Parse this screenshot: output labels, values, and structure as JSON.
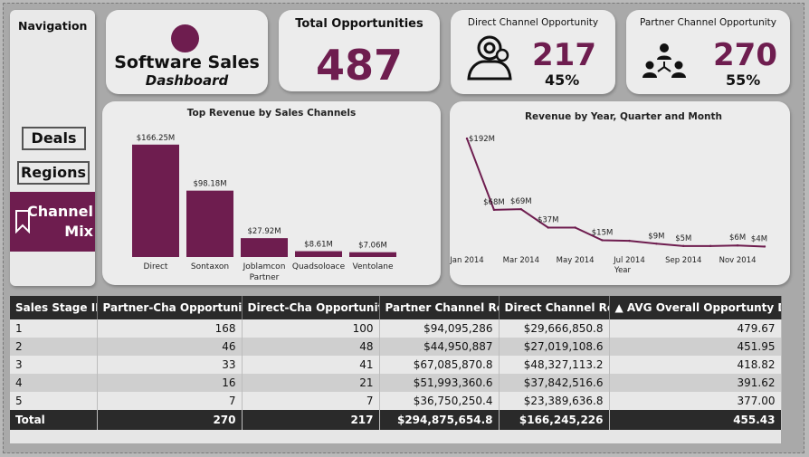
{
  "nav": {
    "title": "Navigation",
    "items": [
      {
        "label": "Deals"
      },
      {
        "label": "Regions"
      },
      {
        "label": "Channel Mix",
        "line1": "Channel",
        "line2": "Mix",
        "active": true,
        "icon": "bookmark-icon"
      }
    ]
  },
  "logo": {
    "title": "Software Sales",
    "subtitle": "Dashboard"
  },
  "kpis": {
    "total": {
      "label": "Total Opportunities",
      "value": "487"
    },
    "direct": {
      "label": "Direct Channel Opportunity",
      "value": "217",
      "pct": "45%",
      "icon": "webcam-user-icon"
    },
    "partner": {
      "label": "Partner Channel Opportunity",
      "value": "270",
      "pct": "55%",
      "icon": "team-network-icon"
    }
  },
  "colors": {
    "accent": "#6e1d4f",
    "dark": "#2a2a2a"
  },
  "chart_data": [
    {
      "type": "bar",
      "title": "Top Revenue by Sales Channels",
      "categories": [
        "Direct",
        "Sontaxon",
        "Joblamcon Partner",
        "Quadsoloace",
        "Ventolane"
      ],
      "category_lines": [
        [
          "Direct"
        ],
        [
          "Sontaxon"
        ],
        [
          "Joblamcon",
          "Partner"
        ],
        [
          "Quadsoloace"
        ],
        [
          "Ventolane"
        ]
      ],
      "values": [
        166.25,
        98.18,
        27.92,
        8.61,
        7.06
      ],
      "data_labels": [
        "$166.25M",
        "$98.18M",
        "$27.92M",
        "$8.61M",
        "$7.06M"
      ],
      "ylim": [
        0,
        170
      ]
    },
    {
      "type": "line",
      "title": "Revenue by Year, Quarter and Month",
      "xlabel": "Year",
      "x": [
        "Jan 2014",
        "Feb 2014",
        "Mar 2014",
        "Apr 2014",
        "May 2014",
        "Jun 2014",
        "Jul 2014",
        "Aug 2014",
        "Sep 2014",
        "Oct 2014",
        "Nov 2014",
        "Dec 2014"
      ],
      "x_tick_labels": [
        "Jan 2014",
        "Mar 2014",
        "May 2014",
        "Jul 2014",
        "Sep 2014",
        "Nov 2014"
      ],
      "values": [
        192,
        68,
        69,
        37,
        37,
        15,
        14,
        9,
        5,
        5,
        6,
        4
      ],
      "data_labels": [
        "$192M",
        "$68M",
        "$69M",
        "$37M",
        "",
        "$15M",
        "",
        "$9M",
        "$5M",
        "",
        "$6M",
        "$4M"
      ],
      "ylim": [
        0,
        200
      ]
    }
  ],
  "table": {
    "columns": [
      "Sales Stage ID",
      "Partner-Cha Opportunity",
      "Direct-Cha Opportunity",
      "Partner Channel Rev",
      "Direct Channel Rev",
      "AVG Overall Opportunty Days"
    ],
    "sort_indicator": "▲",
    "rows": [
      [
        "1",
        "168",
        "100",
        "$94,095,286",
        "$29,666,850.8",
        "479.67"
      ],
      [
        "2",
        "46",
        "48",
        "$44,950,887",
        "$27,019,108.6",
        "451.95"
      ],
      [
        "3",
        "33",
        "41",
        "$67,085,870.8",
        "$48,327,113.2",
        "418.82"
      ],
      [
        "4",
        "16",
        "21",
        "$51,993,360.6",
        "$37,842,516.6",
        "391.62"
      ],
      [
        "5",
        "7",
        "7",
        "$36,750,250.4",
        "$23,389,636.8",
        "377.00"
      ]
    ],
    "total": [
      "Total",
      "270",
      "217",
      "$294,875,654.8",
      "$166,245,226",
      "455.43"
    ]
  }
}
